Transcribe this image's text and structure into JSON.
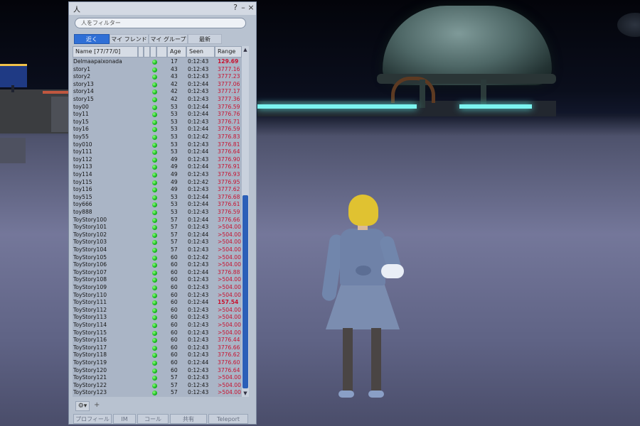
{
  "window": {
    "title": "人",
    "help_glyph": "?",
    "minimize_glyph": "–",
    "close_glyph": "×"
  },
  "filter": {
    "placeholder": "人をフィルター",
    "value": ""
  },
  "tabs": [
    {
      "label": "近く",
      "active": true
    },
    {
      "label": "マイ フレンド",
      "active": false
    },
    {
      "label": "マイ グループ",
      "active": false
    },
    {
      "label": "最新",
      "active": false
    }
  ],
  "columns": {
    "name": "Name [77/77/0]",
    "age": "Age",
    "seen": "Seen",
    "range": "Range"
  },
  "rows": [
    {
      "name": "Delmaapaixonada",
      "age": "17",
      "seen": "0:12:43",
      "range": "129.69",
      "near": true
    },
    {
      "name": "story1",
      "age": "43",
      "seen": "0:12:43",
      "range": "3777.16"
    },
    {
      "name": "story2",
      "age": "43",
      "seen": "0:12:43",
      "range": "3777.23"
    },
    {
      "name": "story13",
      "age": "42",
      "seen": "0:12:44",
      "range": "3777.06"
    },
    {
      "name": "story14",
      "age": "42",
      "seen": "0:12:43",
      "range": "3777.17"
    },
    {
      "name": "story15",
      "age": "42",
      "seen": "0:12:43",
      "range": "3777.36"
    },
    {
      "name": "toy00",
      "age": "53",
      "seen": "0:12:44",
      "range": "3776.59"
    },
    {
      "name": "toy11",
      "age": "53",
      "seen": "0:12:44",
      "range": "3776.76"
    },
    {
      "name": "toy15",
      "age": "53",
      "seen": "0:12:43",
      "range": "3776.71"
    },
    {
      "name": "toy16",
      "age": "53",
      "seen": "0:12:44",
      "range": "3776.59"
    },
    {
      "name": "toy55",
      "age": "53",
      "seen": "0:12:42",
      "range": "3776.83"
    },
    {
      "name": "toy010",
      "age": "53",
      "seen": "0:12:43",
      "range": "3776.81"
    },
    {
      "name": "toy111",
      "age": "53",
      "seen": "0:12:44",
      "range": "3776.64"
    },
    {
      "name": "toy112",
      "age": "49",
      "seen": "0:12:43",
      "range": "3776.90"
    },
    {
      "name": "toy113",
      "age": "49",
      "seen": "0:12:44",
      "range": "3776.91"
    },
    {
      "name": "toy114",
      "age": "49",
      "seen": "0:12:43",
      "range": "3776.93"
    },
    {
      "name": "toy115",
      "age": "49",
      "seen": "0:12:42",
      "range": "3776.95"
    },
    {
      "name": "toy116",
      "age": "49",
      "seen": "0:12:43",
      "range": "3777.62"
    },
    {
      "name": "toy515",
      "age": "53",
      "seen": "0:12:44",
      "range": "3776.68"
    },
    {
      "name": "toy666",
      "age": "53",
      "seen": "0:12:44",
      "range": "3776.61"
    },
    {
      "name": "toy888",
      "age": "53",
      "seen": "0:12:43",
      "range": "3776.59"
    },
    {
      "name": "ToyStory100",
      "age": "57",
      "seen": "0:12:44",
      "range": "3776.66"
    },
    {
      "name": "ToyStory101",
      "age": "57",
      "seen": "0:12:43",
      "range": ">504.00"
    },
    {
      "name": "ToyStory102",
      "age": "57",
      "seen": "0:12:44",
      "range": ">504.00"
    },
    {
      "name": "ToyStory103",
      "age": "57",
      "seen": "0:12:43",
      "range": ">504.00"
    },
    {
      "name": "ToyStory104",
      "age": "57",
      "seen": "0:12:43",
      "range": ">504.00"
    },
    {
      "name": "ToyStory105",
      "age": "60",
      "seen": "0:12:42",
      "range": ">504.00"
    },
    {
      "name": "ToyStory106",
      "age": "60",
      "seen": "0:12:43",
      "range": ">504.00"
    },
    {
      "name": "ToyStory107",
      "age": "60",
      "seen": "0:12:44",
      "range": "3776.88"
    },
    {
      "name": "ToyStory108",
      "age": "60",
      "seen": "0:12:43",
      "range": ">504.00"
    },
    {
      "name": "ToyStory109",
      "age": "60",
      "seen": "0:12:43",
      "range": ">504.00"
    },
    {
      "name": "ToyStory110",
      "age": "60",
      "seen": "0:12:43",
      "range": ">504.00"
    },
    {
      "name": "ToyStory111",
      "age": "60",
      "seen": "0:12:44",
      "range": "157.54",
      "near": true
    },
    {
      "name": "ToyStory112",
      "age": "60",
      "seen": "0:12:43",
      "range": ">504.00"
    },
    {
      "name": "ToyStory113",
      "age": "60",
      "seen": "0:12:43",
      "range": ">504.00"
    },
    {
      "name": "ToyStory114",
      "age": "60",
      "seen": "0:12:43",
      "range": ">504.00"
    },
    {
      "name": "ToyStory115",
      "age": "60",
      "seen": "0:12:43",
      "range": ">504.00"
    },
    {
      "name": "ToyStory116",
      "age": "60",
      "seen": "0:12:43",
      "range": "3776.44"
    },
    {
      "name": "ToyStory117",
      "age": "60",
      "seen": "0:12:43",
      "range": "3776.66"
    },
    {
      "name": "ToyStory118",
      "age": "60",
      "seen": "0:12:43",
      "range": "3776.62"
    },
    {
      "name": "ToyStory119",
      "age": "60",
      "seen": "0:12:44",
      "range": "3776.60"
    },
    {
      "name": "ToyStory120",
      "age": "60",
      "seen": "0:12:43",
      "range": "3776.64"
    },
    {
      "name": "ToyStory121",
      "age": "57",
      "seen": "0:12:43",
      "range": ">504.00"
    },
    {
      "name": "ToyStory122",
      "age": "57",
      "seen": "0:12:43",
      "range": ">504.00"
    },
    {
      "name": "ToyStory123",
      "age": "57",
      "seen": "0:12:43",
      "range": ">504.00"
    }
  ],
  "bottom": {
    "gear_glyph": "⚙▾",
    "plus_glyph": "+",
    "buttons": [
      "プロフィール",
      "IM",
      "コール",
      "共有",
      "Teleport"
    ]
  },
  "colors": {
    "active_tab": "#2f6fd6",
    "range_text": "#c8102e",
    "online_dot": "#16b81e",
    "scroll_thumb": "#2b5fb8"
  },
  "icons": {
    "status": "online-dot-icon",
    "settings": "gear-icon",
    "add": "plus-icon",
    "scroll_up": "scroll-up-arrow-icon",
    "scroll_down": "scroll-down-arrow-icon"
  }
}
